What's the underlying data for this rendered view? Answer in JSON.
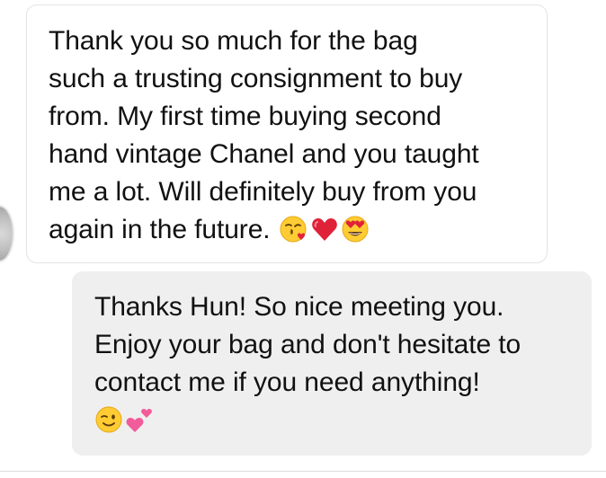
{
  "conversation": {
    "incoming": {
      "lines": [
        "Thank you so much for the bag",
        "such a trusting consignment to buy",
        "from. My first time buying second",
        "hand vintage Chanel and you taught",
        "me a lot. Will definitely buy from you",
        "again in the future."
      ],
      "emojis": [
        "face-blowing-kiss-icon",
        "red-heart-icon",
        "heart-eyes-face-icon"
      ]
    },
    "outgoing": {
      "lines": [
        "Thanks Hun! So nice meeting you.",
        "Enjoy your bag and don't hesitate to",
        "contact me if you need anything!"
      ],
      "emojis": [
        "winking-face-icon",
        "two-hearts-icon"
      ]
    }
  },
  "colors": {
    "incoming_bubble_bg": "#ffffff",
    "incoming_bubble_border": "#e3e3e3",
    "outgoing_bubble_bg": "#efefef",
    "text": "#111111"
  }
}
